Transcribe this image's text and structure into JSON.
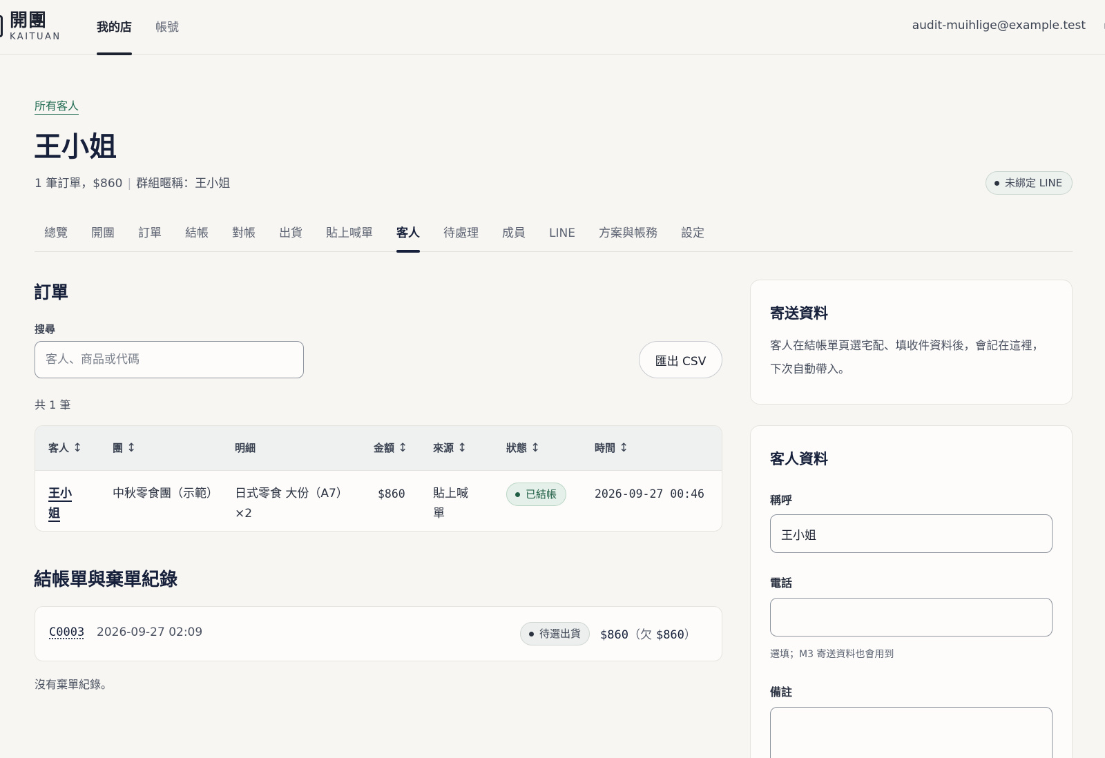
{
  "app": {
    "brand_zh": "開團",
    "brand_en": "KAITUAN",
    "nav": [
      "我的店",
      "帳號"
    ],
    "account_email": "audit-muihlige@example.test"
  },
  "header": {
    "breadcrumb": "所有客人",
    "title": "王小姐",
    "summary_orders": "1 筆訂單，$860",
    "summary_group": "群組暱稱：王小姐",
    "line_badge": "未綁定 LINE"
  },
  "tabs": [
    "總覽",
    "開團",
    "訂單",
    "結帳",
    "對帳",
    "出貨",
    "貼上喊單",
    "客人",
    "待處理",
    "成員",
    "LINE",
    "方案與帳務",
    "設定"
  ],
  "active_tab": "客人",
  "orders": {
    "heading": "訂單",
    "search_label": "搜尋",
    "search_placeholder": "客人、商品或代碼",
    "export_label": "匯出 CSV",
    "count_text": "共 1 筆",
    "columns": [
      "客人",
      "團",
      "明細",
      "金額",
      "來源",
      "狀態",
      "時間"
    ],
    "sort_glyph": "↕",
    "rows": [
      {
        "customer": "王小姐",
        "group": "中秋零食團（示範）",
        "detail": "日式零食 大份（A7）×2",
        "amount": "$860",
        "source": "貼上喊單",
        "status": "已結帳",
        "time": "2026-09-27 00:46"
      }
    ]
  },
  "checkouts": {
    "heading": "結帳單與棄單紀錄",
    "items": [
      {
        "id": "C0003",
        "time": "2026-09-27 02:09",
        "status": "待選出貨",
        "amount": "$860",
        "owed_prefix": "（欠",
        "owed": "$860",
        "owed_suffix": "）"
      }
    ],
    "no_abandon": "沒有棄單紀錄。"
  },
  "shipping": {
    "title": "寄送資料",
    "description": "客人在結帳單頁選宅配、填收件資料後，會記在這裡，下次自動帶入。"
  },
  "customer_info": {
    "title": "客人資料",
    "name_label": "稱呼",
    "name_value": "王小姐",
    "phone_label": "電話",
    "phone_value": "",
    "phone_hint": "選填；M3 寄送資料也會用到",
    "note_label": "備註",
    "note_value": ""
  },
  "colors": {
    "background": "#f8f6f2",
    "accent_green": "#1f6b52",
    "text_dark": "#16203a"
  }
}
